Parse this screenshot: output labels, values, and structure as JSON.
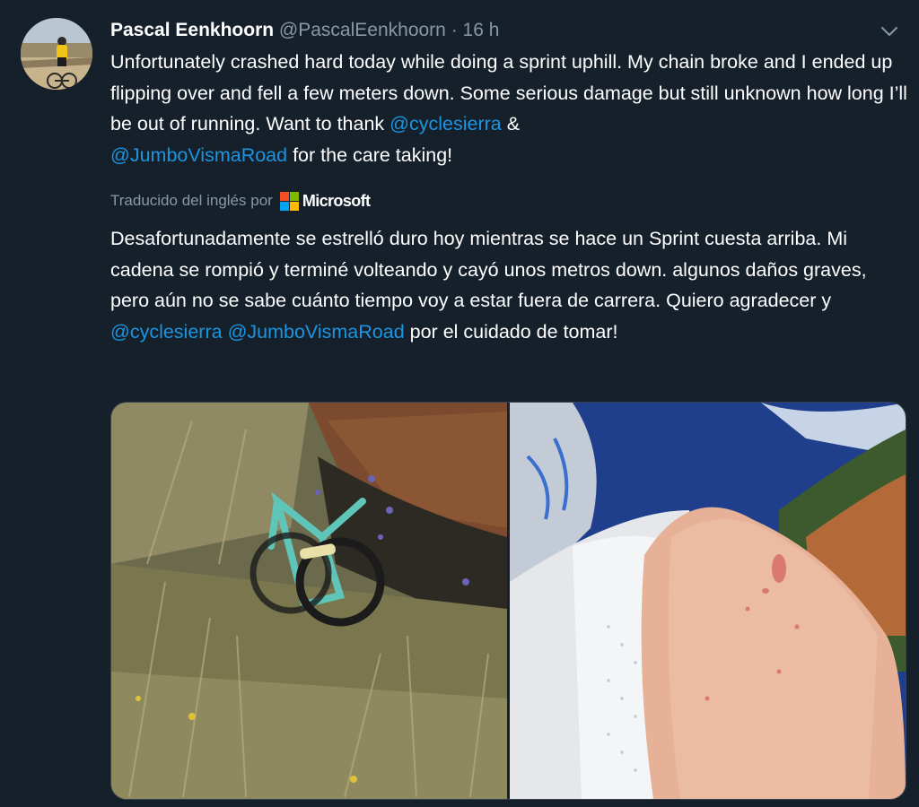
{
  "tweet": {
    "author_name": "Pascal Eenkhoorn",
    "handle": "@PascalEenkhoorn",
    "separator": "·",
    "time": "16 h",
    "text_before": "Unfortunately crashed hard today while doing a sprint uphill. My chain broke and I ended up flipping over and fell a few meters down. Some serious damage but still unknown how long I’ll be out of running. Want to thank ",
    "mention_1": "@cyclesierra",
    "text_middle": " & ",
    "mention_2": "@JumboVismaRoad",
    "text_after": " for the care taking!"
  },
  "translation": {
    "label": "Traducido del inglés por",
    "provider": "Microsoft",
    "text_before": "Desafortunadamente se estrelló duro hoy mientras se hace un Sprint cuesta arriba. Mi cadena se rompió y terminé volteando y cayó unos metros down. algunos daños graves, pero aún no se sabe cuánto tiempo voy a estar fuera de carrera. Quiero agradecer y ",
    "mention_1": "@cyclesierra",
    "text_middle": " ",
    "mention_2": "@JumboVismaRoad",
    "text_after": " por el cuidado de tomar!"
  },
  "icons": {
    "caret": "chevron-down-icon",
    "provider_logo": "microsoft-logo-icon"
  },
  "colors": {
    "background": "#15202b",
    "secondary_text": "#8899a6",
    "link": "#1b95e0",
    "ms_red": "#f25022",
    "ms_green": "#7fba00",
    "ms_blue": "#00a4ef",
    "ms_yellow": "#ffb900"
  },
  "media": {
    "photo_count": 2
  }
}
